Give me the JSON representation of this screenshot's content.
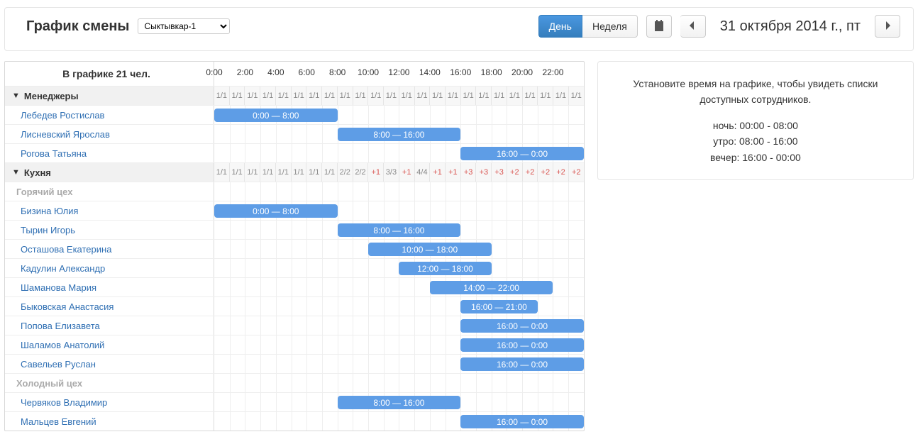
{
  "header": {
    "title": "График смены",
    "location_selected": "Сыктывкар-1",
    "view_day": "День",
    "view_week": "Неделя",
    "date": "31 октября 2014 г., пт"
  },
  "hours": [
    "0:00",
    "2:00",
    "4:00",
    "6:00",
    "8:00",
    "10:00",
    "12:00",
    "14:00",
    "16:00",
    "18:00",
    "20:00",
    "22:00"
  ],
  "summary_label": "В графике 21 чел.",
  "side": {
    "help": "Установите время на графике, чтобы увидеть списки доступных сотрудников.",
    "night": "ночь: 00:00 - 08:00",
    "morning": "утро: 08:00 - 16:00",
    "evening": "вечер: 16:00 - 00:00"
  },
  "groups": [
    {
      "name": "Менеджеры",
      "ratios": [
        "1/1",
        "1/1",
        "1/1",
        "1/1",
        "1/1",
        "1/1",
        "1/1",
        "1/1",
        "1/1",
        "1/1",
        "1/1",
        "1/1",
        "1/1",
        "1/1",
        "1/1",
        "1/1",
        "1/1",
        "1/1",
        "1/1",
        "1/1",
        "1/1",
        "1/1",
        "1/1",
        "1/1"
      ],
      "rows": [
        {
          "name": "Лебедев Ростислав",
          "start": 0,
          "end": 8,
          "label": "0:00 — 8:00"
        },
        {
          "name": "Лисневский Ярослав",
          "start": 8,
          "end": 16,
          "label": "8:00 — 16:00"
        },
        {
          "name": "Рогова Татьяна",
          "start": 16,
          "end": 24,
          "label": "16:00 — 0:00"
        }
      ]
    },
    {
      "name": "Кухня",
      "ratios": [
        "1/1",
        "1/1",
        "1/1",
        "1/1",
        "1/1",
        "1/1",
        "1/1",
        "1/1",
        "2/2",
        "2/2",
        "+1",
        "3/3",
        "+1",
        "4/4",
        "+1",
        "+1",
        "+3",
        "+3",
        "+3",
        "+2",
        "+2",
        "+2",
        "+2",
        "+2"
      ],
      "subgroups": [
        {
          "name": "Горячий цех",
          "rows": [
            {
              "name": "Бизина Юлия",
              "start": 0,
              "end": 8,
              "label": "0:00 — 8:00"
            },
            {
              "name": "Тырин Игорь",
              "start": 8,
              "end": 16,
              "label": "8:00 — 16:00"
            },
            {
              "name": "Осташова Екатерина",
              "start": 10,
              "end": 18,
              "label": "10:00 — 18:00"
            },
            {
              "name": "Кадулин Александр",
              "start": 12,
              "end": 18,
              "label": "12:00 — 18:00"
            },
            {
              "name": "Шаманова Мария",
              "start": 14,
              "end": 22,
              "label": "14:00 — 22:00"
            },
            {
              "name": "Быковская Анастасия",
              "start": 16,
              "end": 21,
              "label": "16:00 — 21:00"
            },
            {
              "name": "Попова Елизавета",
              "start": 16,
              "end": 24,
              "label": "16:00 — 0:00"
            },
            {
              "name": "Шаламов Анатолий",
              "start": 16,
              "end": 24,
              "label": "16:00 — 0:00"
            },
            {
              "name": "Савельев Руслан",
              "start": 16,
              "end": 24,
              "label": "16:00 — 0:00"
            }
          ]
        },
        {
          "name": "Холодный цех",
          "rows": [
            {
              "name": "Червяков Владимир",
              "start": 8,
              "end": 16,
              "label": "8:00 — 16:00"
            },
            {
              "name": "Мальцев Евгений",
              "start": 16,
              "end": 24,
              "label": "16:00 — 0:00"
            }
          ]
        }
      ]
    }
  ]
}
